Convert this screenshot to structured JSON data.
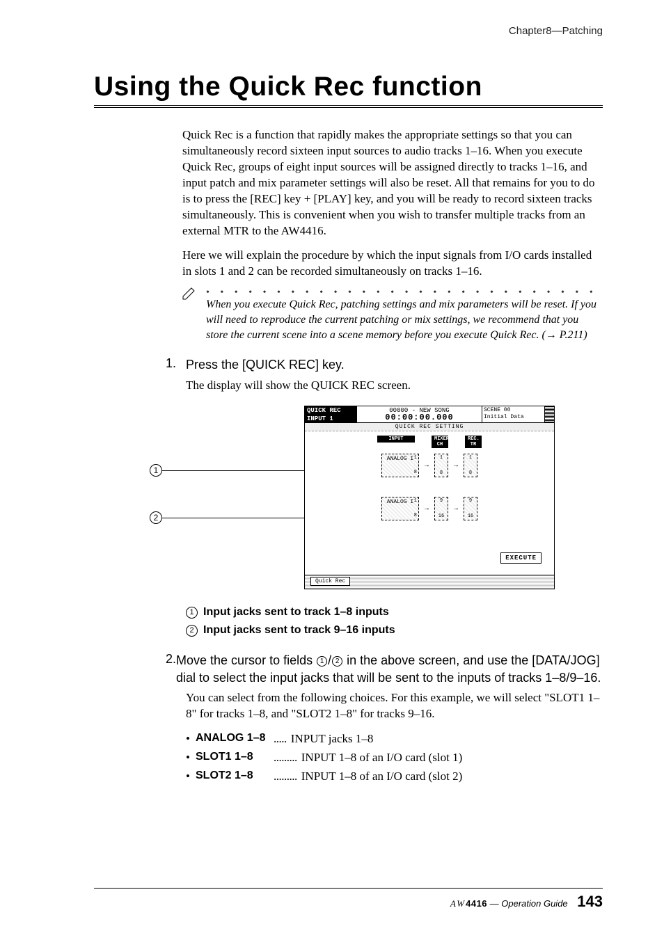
{
  "chapter": "Chapter8—Patching",
  "title": "Using the Quick Rec function",
  "intro1": "Quick Rec is a function that rapidly makes the appropriate settings so that you can simultaneously record sixteen input sources to audio tracks 1–16. When you execute Quick Rec, groups of eight input sources will be assigned directly to tracks 1–16, and input patch and mix parameter settings will also be reset. All that remains for you to do is to press the [REC] key + [PLAY] key, and you will be ready to record sixteen tracks simultaneously. This is convenient when you wish to transfer multiple tracks from an external MTR to the AW4416.",
  "intro2": "Here we will explain the procedure by which the input signals from I/O cards installed in slots 1 and 2 can be recorded simultaneously on tracks 1–16.",
  "note": "When you execute Quick Rec, patching settings and mix parameters will be reset. If you will need to reproduce the current patching or mix settings, we recommend that you store the current scene into a scene memory before you execute Quick Rec. (→ P.211)",
  "step1_num": "1.",
  "step1_head": "Press the [QUICK REC] key.",
  "step1_body": "The display will show the QUICK REC screen.",
  "ss": {
    "topleft1": "QUICK REC",
    "topleft2": "INPUT 1",
    "songname": "00000 - NEW SONG",
    "time": "00:00:00.000",
    "scene1": "SCENE 00",
    "scene2": "Initial Data",
    "header2": "QUICK REC SETTING",
    "col_input": "INPUT",
    "col_mixer": "MIXER\nCH",
    "col_rec": "REC.\nTR",
    "grp1_label": "ANALOG I",
    "grp1_a1": "1",
    "grp1_a2": "8",
    "grp1_b1": "1",
    "grp1_b2": "8",
    "grp1_c1": "1",
    "grp1_c2": "8",
    "grp2_label": "ANALOG I",
    "grp2_a1": "1",
    "grp2_a2": "8",
    "grp2_b1": "9",
    "grp2_b2": "16",
    "grp2_c1": "9",
    "grp2_c2": "16",
    "exec": "EXECUTE",
    "tab": "Quick Rec"
  },
  "legend1": "Input jacks sent to track 1–8 inputs",
  "legend2": "Input jacks sent to track 9–16 inputs",
  "step2_num": "2.",
  "step2_head_a": "Move the cursor to fields ",
  "step2_head_b": "/",
  "step2_head_c": " in the above screen, and use the [DATA/JOG] dial to select the input jacks that will be sent to the inputs of tracks 1–8/9–16.",
  "step2_body": "You can select from the following choices. For this example, we will select \"SLOT1 1–8\" for tracks 1–8, and \"SLOT2 1–8\" for tracks 9–16.",
  "choices": {
    "a_label": "ANALOG 1–8",
    "a_dots": ".....",
    "a_desc": "INPUT jacks 1–8",
    "b_label": "SLOT1 1–8",
    "b_dots": ".........",
    "b_desc": "INPUT 1–8 of an I/O card (slot 1)",
    "c_label": "SLOT2 1–8",
    "c_dots": ".........",
    "c_desc": "INPUT 1–8 of an I/O card (slot 2)"
  },
  "footer": {
    "aw": "AW",
    "model": "4416",
    "guide": " — Operation Guide",
    "page": "143"
  }
}
